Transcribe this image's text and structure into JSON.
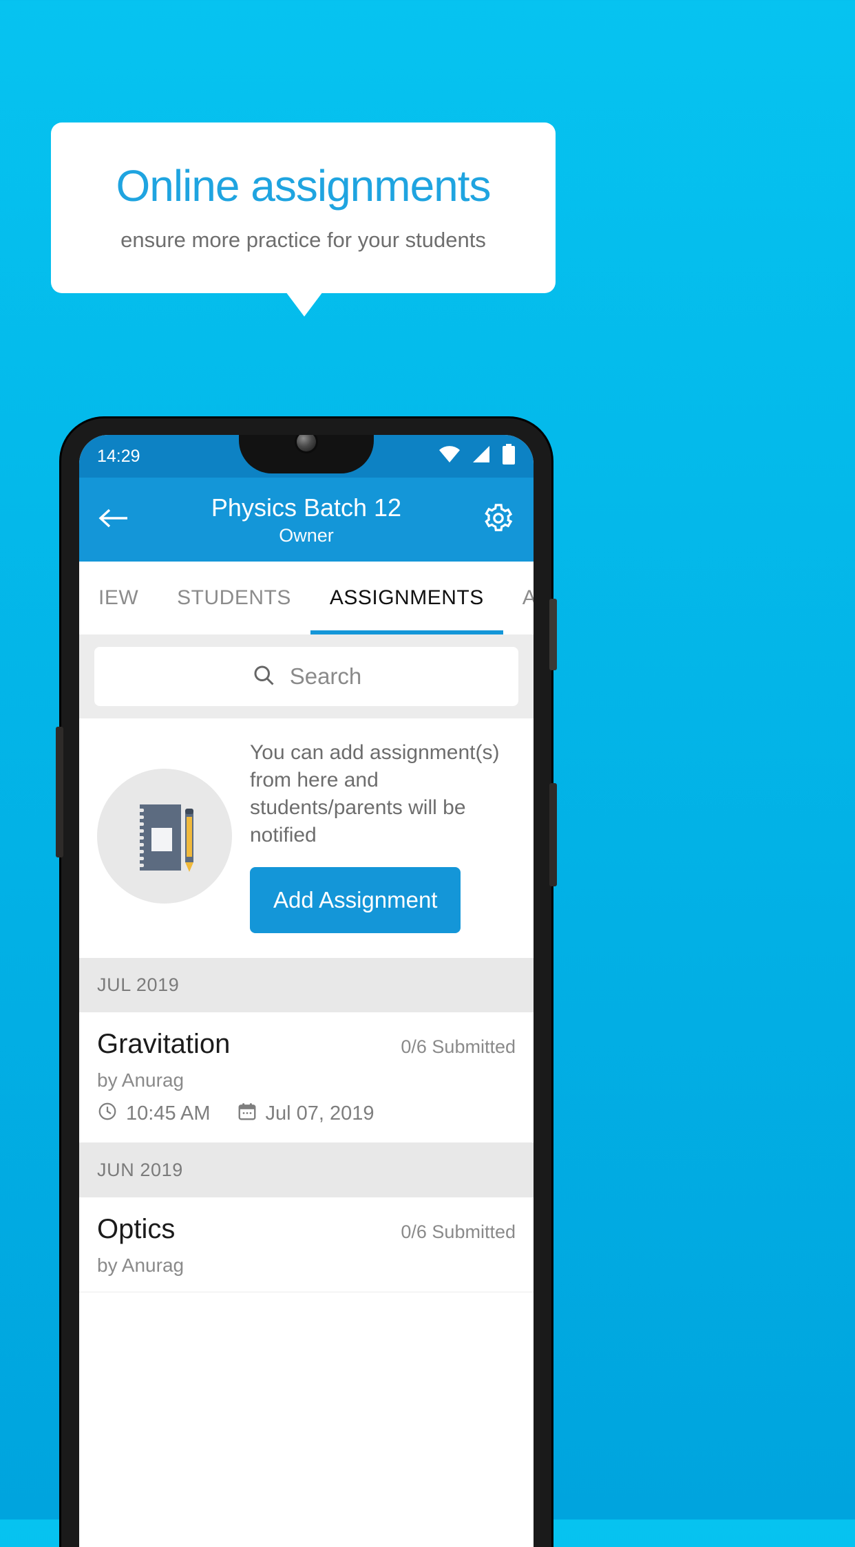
{
  "promo": {
    "title": "Online assignments",
    "subtitle": "ensure more practice for your students"
  },
  "colors": {
    "background_top": "#06C3F0",
    "background_bottom": "#00A4DE",
    "brand_blue": "#1496D8",
    "title_blue": "#1FA4E0",
    "statusbar_blue": "#0D82C4",
    "section_gray": "#E8E8E8"
  },
  "phone": {
    "statusbar": {
      "time": "14:29",
      "icons": [
        "wifi-icon",
        "cellular-signal-icon",
        "battery-icon"
      ]
    },
    "appbar": {
      "back_icon": "arrow-left-icon",
      "title": "Physics Batch 12",
      "subtitle": "Owner",
      "settings_icon": "gear-icon"
    },
    "tabs": [
      {
        "label": "IEW",
        "active": false
      },
      {
        "label": "STUDENTS",
        "active": false
      },
      {
        "label": "ASSIGNMENTS",
        "active": true
      },
      {
        "label": "ANNOUNCEM",
        "active": false
      }
    ],
    "search": {
      "icon": "search-icon",
      "placeholder": "Search",
      "value": ""
    },
    "empty_state": {
      "illustration": "notebook-and-pen-icon",
      "text": "You can add assignment(s) from here and students/parents will be notified",
      "button_label": "Add Assignment"
    },
    "sections": [
      {
        "month": "JUL 2019",
        "items": [
          {
            "title": "Gravitation",
            "status": "0/6 Submitted",
            "author": "by Anurag",
            "time_icon": "clock-icon",
            "time": "10:45 AM",
            "date_icon": "calendar-icon",
            "date": "Jul 07, 2019"
          }
        ]
      },
      {
        "month": "JUN 2019",
        "items": [
          {
            "title": "Optics",
            "status": "0/6 Submitted",
            "author": "by Anurag",
            "time_icon": "clock-icon",
            "time": "",
            "date_icon": "calendar-icon",
            "date": ""
          }
        ]
      }
    ]
  }
}
